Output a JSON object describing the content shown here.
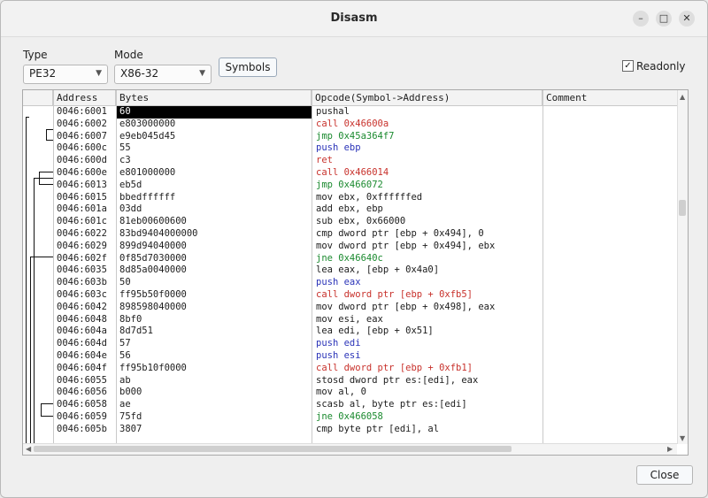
{
  "window": {
    "title": "Disasm",
    "close_label": "Close"
  },
  "toolbar": {
    "type_label": "Type",
    "type_value": "PE32",
    "mode_label": "Mode",
    "mode_value": "X86-32",
    "symbols_label": "Symbols",
    "readonly_label": "Readonly",
    "readonly_checked": true
  },
  "columns": [
    "Address",
    "Bytes",
    "Opcode(Symbol->Address)",
    "Comment"
  ],
  "colors": {
    "call": "#c8322c",
    "push": "#2b34b8",
    "jump": "#1b8a2f",
    "normal": "#1c1c1c",
    "selection": "#000000"
  },
  "rows": [
    {
      "address": "0046:6001",
      "bytes": "60",
      "opcode": "pushal",
      "kind": "normal"
    },
    {
      "address": "0046:6002",
      "bytes": "e803000000",
      "opcode": "call 0x46600a",
      "kind": "call"
    },
    {
      "address": "0046:6007",
      "bytes": "e9eb045d45",
      "opcode": "jmp 0x45a364f7",
      "kind": "jump"
    },
    {
      "address": "0046:600c",
      "bytes": "55",
      "opcode": "push ebp",
      "kind": "push"
    },
    {
      "address": "0046:600d",
      "bytes": "c3",
      "opcode": "ret",
      "kind": "call"
    },
    {
      "address": "0046:600e",
      "bytes": "e801000000",
      "opcode": "call 0x466014",
      "kind": "call"
    },
    {
      "address": "0046:6013",
      "bytes": "eb5d",
      "opcode": "jmp 0x466072",
      "kind": "jump"
    },
    {
      "address": "0046:6015",
      "bytes": "bbedffffff",
      "opcode": "mov ebx, 0xffffffed",
      "kind": "normal"
    },
    {
      "address": "0046:601a",
      "bytes": "03dd",
      "opcode": "add ebx, ebp",
      "kind": "normal"
    },
    {
      "address": "0046:601c",
      "bytes": "81eb00600600",
      "opcode": "sub ebx, 0x66000",
      "kind": "normal"
    },
    {
      "address": "0046:6022",
      "bytes": "83bd9404000000",
      "opcode": "cmp dword ptr [ebp + 0x494], 0",
      "kind": "normal"
    },
    {
      "address": "0046:6029",
      "bytes": "899d94040000",
      "opcode": "mov dword ptr [ebp + 0x494], ebx",
      "kind": "normal"
    },
    {
      "address": "0046:602f",
      "bytes": "0f85d7030000",
      "opcode": "jne 0x46640c",
      "kind": "jump"
    },
    {
      "address": "0046:6035",
      "bytes": "8d85a0040000",
      "opcode": "lea eax, [ebp + 0x4a0]",
      "kind": "normal"
    },
    {
      "address": "0046:603b",
      "bytes": "50",
      "opcode": "push eax",
      "kind": "push"
    },
    {
      "address": "0046:603c",
      "bytes": "ff95b50f0000",
      "opcode": "call dword ptr [ebp + 0xfb5]",
      "kind": "call"
    },
    {
      "address": "0046:6042",
      "bytes": "898598040000",
      "opcode": "mov dword ptr [ebp + 0x498], eax",
      "kind": "normal"
    },
    {
      "address": "0046:6048",
      "bytes": "8bf0",
      "opcode": "mov esi, eax",
      "kind": "normal"
    },
    {
      "address": "0046:604a",
      "bytes": "8d7d51",
      "opcode": "lea edi, [ebp + 0x51]",
      "kind": "normal"
    },
    {
      "address": "0046:604d",
      "bytes": "57",
      "opcode": "push edi",
      "kind": "push"
    },
    {
      "address": "0046:604e",
      "bytes": "56",
      "opcode": "push esi",
      "kind": "push"
    },
    {
      "address": "0046:604f",
      "bytes": "ff95b10f0000",
      "opcode": "call dword ptr [ebp + 0xfb1]",
      "kind": "call"
    },
    {
      "address": "0046:6055",
      "bytes": "ab",
      "opcode": "stosd dword ptr es:[edi], eax",
      "kind": "normal"
    },
    {
      "address": "0046:6056",
      "bytes": "b000",
      "opcode": "mov al, 0",
      "kind": "normal"
    },
    {
      "address": "0046:6058",
      "bytes": "ae",
      "opcode": "scasb al, byte ptr es:[edi]",
      "kind": "normal"
    },
    {
      "address": "0046:6059",
      "bytes": "75fd",
      "opcode": "jne 0x466058",
      "kind": "jump"
    },
    {
      "address": "0046:605b",
      "bytes": "3807",
      "opcode": "cmp byte ptr [edi], al",
      "kind": "normal"
    }
  ],
  "selected_row": 0
}
